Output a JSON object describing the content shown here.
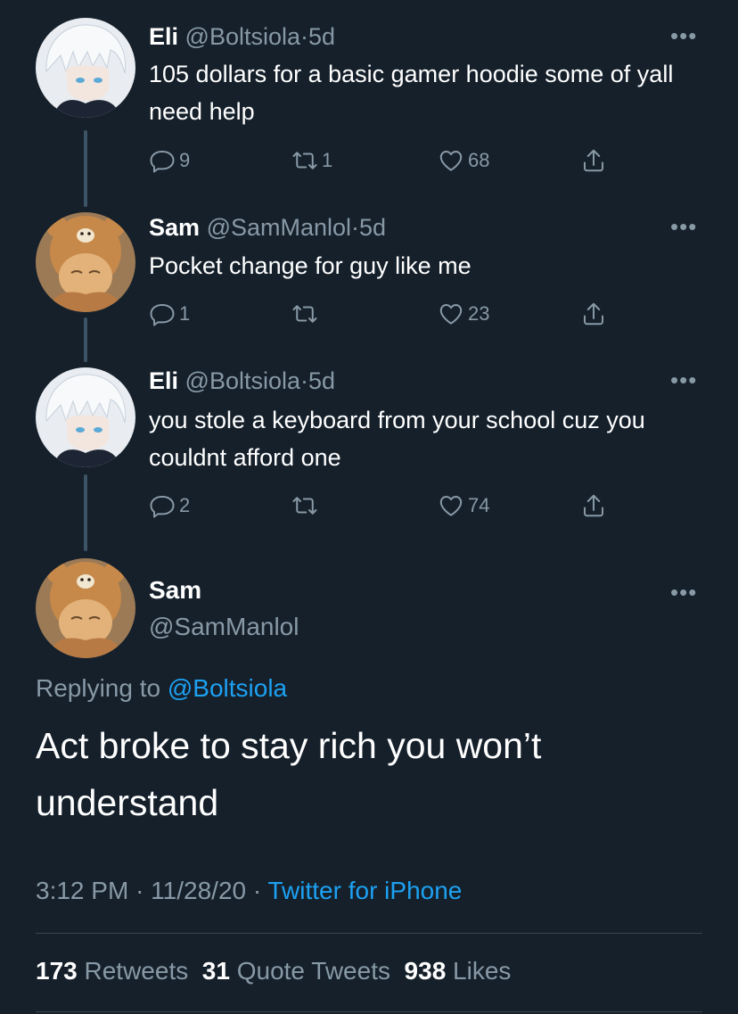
{
  "tweets": [
    {
      "name": "Eli",
      "handle": "@Boltsiola",
      "dot": "·",
      "time": "5d",
      "text": "105 dollars for a basic gamer hoodie some of yall need help",
      "reply_count": "9",
      "retweet_count": "1",
      "like_count": "68"
    },
    {
      "name": "Sam",
      "handle": "@SamManlol",
      "dot": "·",
      "time": "5d",
      "text": "Pocket change for guy like me",
      "reply_count": "1",
      "retweet_count": "",
      "like_count": "23"
    },
    {
      "name": "Eli",
      "handle": "@Boltsiola",
      "dot": "·",
      "time": "5d",
      "text": "you stole a keyboard from your school cuz you couldnt afford one",
      "reply_count": "2",
      "retweet_count": "",
      "like_count": "74"
    }
  ],
  "main": {
    "name": "Sam",
    "handle": "@SamManlol",
    "replying_prefix": "Replying to",
    "replying_to": "@Boltsiola",
    "text": "Act broke to stay rich you won’t understand",
    "time": "3:12 PM",
    "sep1": "·",
    "date": "11/28/20",
    "sep2": "·",
    "source": "Twitter for iPhone",
    "retweets": "173",
    "retweets_label": "Retweets",
    "quotes": "31",
    "quotes_label": "Quote Tweets",
    "likes": "938",
    "likes_label": "Likes"
  },
  "more_glyph": "•••",
  "colors": {
    "background": "#15202b",
    "secondary": "#8899a6",
    "link": "#1da1f2",
    "line": "#3d5466"
  },
  "icons": [
    "reply-icon",
    "retweet-icon",
    "like-icon",
    "share-icon",
    "more-icon"
  ]
}
